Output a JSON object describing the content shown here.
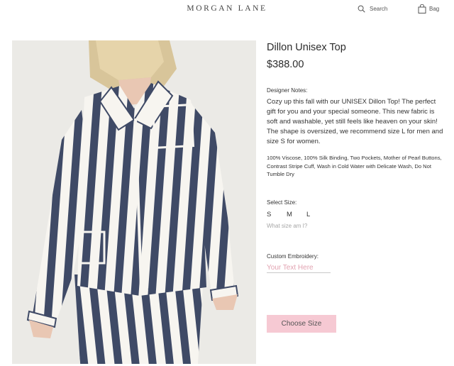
{
  "header": {
    "brand": "MORGAN LANE",
    "search_label": "Search",
    "bag_label": "Bag",
    "icons": {
      "search": "search-icon",
      "bag": "bag-icon"
    }
  },
  "product": {
    "image": "striped-pajama-top-photo",
    "title": "Dillon Unisex Top",
    "price": "$388.00",
    "notes_label": "Designer Notes:",
    "notes_body": "Cozy up this fall with our UNISEX Dillon Top! The perfect gift for you and your special someone. This new fabric is soft and washable, yet still feels like heaven on your skin! The shape is oversized, we recommend size L for men and size S for women.",
    "materials": "100% Viscose, 100% Silk Binding, Two Pockets, Mother of Pearl Buttons, Contrast Stripe Cuff, Wash in Cold Water with Delicate Wash, Do Not Tumble Dry"
  },
  "size": {
    "label": "Select Size:",
    "options": [
      "S",
      "M",
      "L"
    ],
    "help_link": "What size am I?"
  },
  "embroidery": {
    "label": "Custom Embroidery:",
    "placeholder": "Your Text Here"
  },
  "cta": {
    "label": "Choose Size"
  },
  "colors": {
    "accent_pink": "#f6c9d3",
    "placeholder_pink": "#e2a3b1",
    "stripe_navy": "#3f4a66",
    "stripe_white": "#f7f5f0"
  }
}
